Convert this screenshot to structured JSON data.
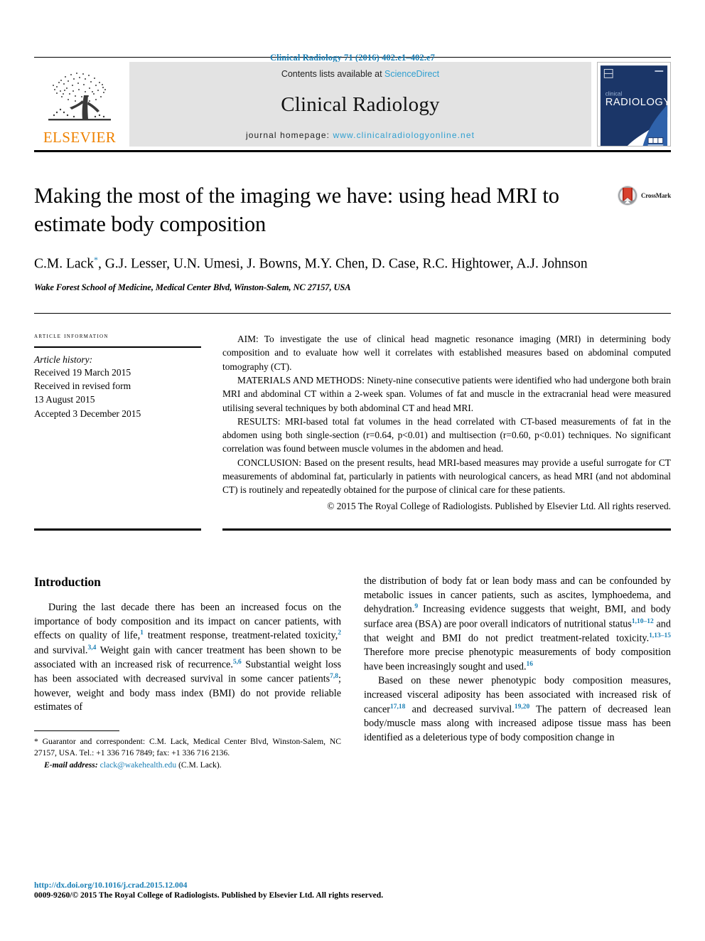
{
  "running_head": "Clinical Radiology 71 (2016) 402.e1–402.e7",
  "masthead": {
    "publisher_name": "ELSEVIER",
    "contents_prefix": "Contents lists available at ",
    "contents_link": "ScienceDirect",
    "journal_name": "Clinical Radiology",
    "homepage_prefix": "journal homepage: ",
    "homepage_url": "www.clinicalradiologyonline.net",
    "cover_title_small": "clinical",
    "cover_title_large": "RADIOLOGY",
    "accent_link_color": "#2f9fd0",
    "publisher_color": "#ef8200"
  },
  "article": {
    "title": "Making the most of the imaging we have: using head MRI to estimate body composition",
    "crossmark_label": "CrossMark",
    "authors": "C.M. Lack*, G.J. Lesser, U.N. Umesi, J. Bowns, M.Y. Chen, D. Case, R.C. Hightower, A.J. Johnson",
    "affiliation": "Wake Forest School of Medicine, Medical Center Blvd, Winston-Salem, NC 27157, USA"
  },
  "article_information": {
    "heading": "Article information",
    "history_label": "Article history:",
    "history_lines": [
      "Received 19 March 2015",
      "Received in revised form",
      "13 August 2015",
      "Accepted 3 December 2015"
    ]
  },
  "abstract": {
    "aim": "AIM: To investigate the use of clinical head magnetic resonance imaging (MRI) in determining body composition and to evaluate how well it correlates with established measures based on abdominal computed tomography (CT).",
    "materials": "MATERIALS AND METHODS: Ninety-nine consecutive patients were identified who had undergone both brain MRI and abdominal CT within a 2-week span. Volumes of fat and muscle in the extracranial head were measured utilising several techniques by both abdominal CT and head MRI.",
    "results": "RESULTS: MRI-based total fat volumes in the head correlated with CT-based measurements of fat in the abdomen using both single-section (r=0.64, p<0.01) and multisection (r=0.60, p<0.01) techniques. No significant correlation was found between muscle volumes in the abdomen and head.",
    "conclusion": "CONCLUSION: Based on the present results, head MRI-based measures may provide a useful surrogate for CT measurements of abdominal fat, particularly in patients with neurological cancers, as head MRI (and not abdominal CT) is routinely and repeatedly obtained for the purpose of clinical care for these patients.",
    "copyright": "© 2015 The Royal College of Radiologists. Published by Elsevier Ltd. All rights reserved."
  },
  "introduction": {
    "heading": "Introduction",
    "left_paragraph_html": "During the last decade there has been an increased focus on the importance of body composition and its impact on cancer patients, with effects on quality of life,<sup>1</sup> treatment response, treatment-related toxicity,<sup>2</sup> and survival.<sup>3,4</sup> Weight gain with cancer treatment has been shown to be associated with an increased risk of recurrence.<sup>5,6</sup> Substantial weight loss has been associated with decreased survival in some cancer patients<sup>7,8</sup>; however, weight and body mass index (BMI) do not provide reliable estimates of",
    "right_paragraph_1_html": "the distribution of body fat or lean body mass and can be confounded by metabolic issues in cancer patients, such as ascites, lymphoedema, and dehydration.<sup>9</sup> Increasing evidence suggests that weight, BMI, and body surface area (BSA) are poor overall indicators of nutritional status<sup>1,10&#8211;12</sup> and that weight and BMI do not predict treatment-related toxicity.<sup>1,13&#8211;15</sup> Therefore more precise phenotypic measurements of body composition have been increasingly sought and used.<sup>16</sup>",
    "right_paragraph_2_html": "Based on these newer phenotypic body composition measures, increased visceral adiposity has been associated with increased risk of cancer<sup>17,18</sup> and decreased survival.<sup>19,20</sup> The pattern of decreased lean body/muscle mass along with increased adipose tissue mass has been identified as a deleterious type of body composition change in"
  },
  "footnote": {
    "correspondence": "* Guarantor and correspondent: C.M. Lack, Medical Center Blvd, Winston-Salem, NC 27157, USA. Tel.: +1 336 716 7849; fax: +1 336 716 2136.",
    "email_label": "E-mail address:",
    "email": "clack@wakehealth.edu",
    "email_suffix": "(C.M. Lack)."
  },
  "page_footer": {
    "doi": "http://dx.doi.org/10.1016/j.crad.2015.12.004",
    "copyright": "0009-9260/© 2015 The Royal College of Radiologists. Published by Elsevier Ltd. All rights reserved."
  }
}
